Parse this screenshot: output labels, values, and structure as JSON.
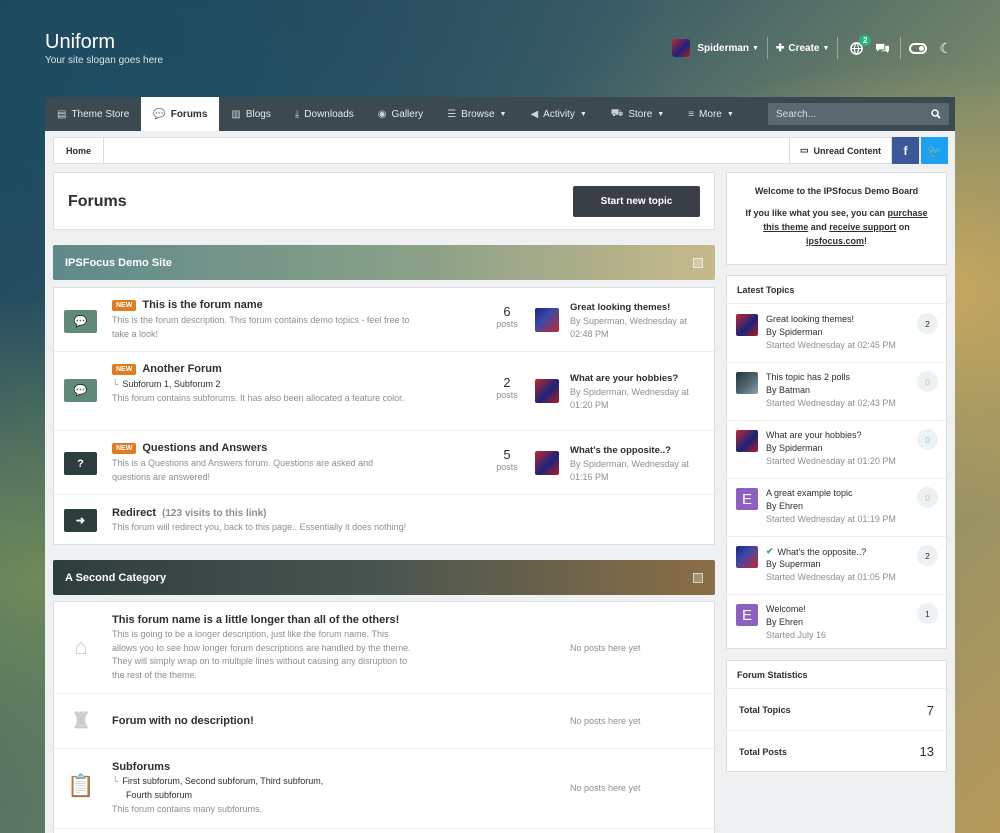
{
  "site": {
    "title": "Uniform",
    "slogan": "Your site slogan goes here"
  },
  "userbar": {
    "username": "Spiderman",
    "create_label": "Create",
    "notification_count": "2"
  },
  "nav": {
    "items": [
      {
        "label": "Theme Store",
        "icon": "document-icon"
      },
      {
        "label": "Forums",
        "icon": "chat-icon"
      },
      {
        "label": "Blogs",
        "icon": "book-icon"
      },
      {
        "label": "Downloads",
        "icon": "download-icon"
      },
      {
        "label": "Gallery",
        "icon": "camera-icon"
      },
      {
        "label": "Browse",
        "icon": "list-icon"
      },
      {
        "label": "Activity",
        "icon": "megaphone-icon"
      },
      {
        "label": "Store",
        "icon": "cart-icon"
      },
      {
        "label": "More",
        "icon": "menu-icon"
      }
    ],
    "search_placeholder": "Search..."
  },
  "breadcrumb": {
    "home": "Home",
    "unread": "Unread Content"
  },
  "page": {
    "title": "Forums",
    "new_topic": "Start new topic"
  },
  "categories": [
    {
      "name": "IPSFocus Demo Site",
      "forums": [
        {
          "title": "This is the forum name",
          "new": "NEW",
          "desc": "This is the forum description. This forum contains demo topics - feel free to take a look!",
          "posts": "6",
          "posts_label": "posts",
          "last_title": "Great looking themes!",
          "last_meta": "By Superman, Wednesday at 02:48 PM"
        },
        {
          "title": "Another Forum",
          "new": "NEW",
          "subforums": "Subforum 1,   Subforum 2",
          "desc": "This forum contains subforums. It has also been allocated a feature color.",
          "posts": "2",
          "posts_label": "posts",
          "last_title": "What are your hobbies?",
          "last_meta": "By Spiderman, Wednesday at 01:20 PM"
        },
        {
          "title": "Questions and Answers",
          "new": "NEW",
          "desc": "This is a Questions and Answers forum. Questions are asked and questions are answered!",
          "posts": "5",
          "posts_label": "posts",
          "last_title": "What's the opposite..?",
          "last_meta": "By Spiderman, Wednesday at 01:16 PM"
        },
        {
          "title": "Redirect",
          "visits": "(123 visits to this link)",
          "desc": "This forum will redirect you, back to this page.. Essentially it does nothing!"
        }
      ]
    },
    {
      "name": "A Second Category",
      "forums": [
        {
          "title": "This forum name is a little longer than all of the others!",
          "desc": "This is going to be a longer description, just like the forum name. This allows you to see how longer forum descriptions are handled by the theme. They will simply wrap on to multiple lines without causing any disruption to the rest of the theme.",
          "noposts": "No posts here yet"
        },
        {
          "title": "Forum with no description!",
          "noposts": "No posts here yet"
        },
        {
          "title": "Subforums",
          "subforums1": "First subforum,   Second subforum,   Third subforum,",
          "subforums2": "Fourth subforum",
          "desc": "This forum contains many subforums.",
          "noposts": "No posts here yet"
        }
      ]
    }
  ],
  "sidebar": {
    "welcome_title": "Welcome to the IPSfocus Demo Board",
    "welcome_pre": "If you like what you see, you can",
    "welcome_link1": "purchase this theme",
    "welcome_and": "and",
    "welcome_link2": "receive support",
    "welcome_on": "on",
    "welcome_link3": "ipsfocus.com",
    "welcome_end": "!",
    "latest_title": "Latest Topics",
    "topics": [
      {
        "title": "Great looking themes!",
        "by": "By Spiderman",
        "started": "Started Wednesday at 02:45 PM",
        "count": "2"
      },
      {
        "title": "This topic has 2 polls",
        "by": "By Batman",
        "started": "Started Wednesday at 02:43 PM",
        "count": "0"
      },
      {
        "title": "What are your hobbies?",
        "by": "By Spiderman",
        "started": "Started Wednesday at 01:20 PM",
        "count": "0"
      },
      {
        "title": "A great example topic",
        "by": "By Ehren",
        "started": "Started Wednesday at 01:19 PM",
        "count": "0",
        "avatar_letter": "E"
      },
      {
        "title": "What's the opposite..?",
        "by": "By Superman",
        "started": "Started Wednesday at 01:05 PM",
        "count": "2"
      },
      {
        "title": "Welcome!",
        "by": "By Ehren",
        "started": "Started July 16",
        "count": "1",
        "avatar_letter": "E"
      }
    ],
    "stats_title": "Forum Statistics",
    "stats": [
      {
        "label": "Total Topics",
        "value": "7"
      },
      {
        "label": "Total Posts",
        "value": "13"
      }
    ]
  },
  "colors": {
    "accent_new": "#e07c1f",
    "nav_bg": "#3a4a50",
    "button_dark": "#3a3f45",
    "facebook": "#3b5998",
    "twitter": "#1da1f2"
  }
}
